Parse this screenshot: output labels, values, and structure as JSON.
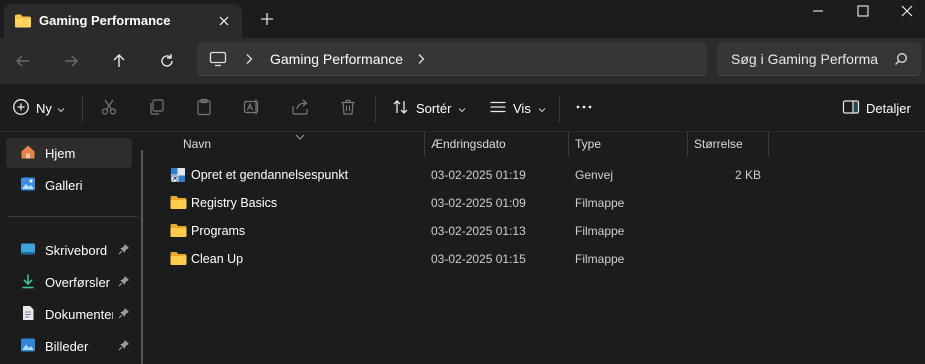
{
  "window": {
    "tab_title": "Gaming Performance",
    "controls": [
      "minimize-icon",
      "maximize-icon",
      "close-icon"
    ]
  },
  "address": {
    "crumb": "Gaming Performance"
  },
  "search": {
    "placeholder": "Søg i Gaming Performa"
  },
  "toolbar": {
    "new_label": "Ny",
    "sort_label": "Sortér",
    "view_label": "Vis",
    "details_label": "Detaljer"
  },
  "sidebar": {
    "items": [
      {
        "label": "Hjem",
        "icon": "home-icon"
      },
      {
        "label": "Galleri",
        "icon": "gallery-icon"
      },
      {
        "label": "Skrivebord",
        "icon": "desktop-icon"
      },
      {
        "label": "Overførsler",
        "icon": "downloads-icon"
      },
      {
        "label": "Dokumenter",
        "icon": "documents-icon"
      },
      {
        "label": "Billeder",
        "icon": "pictures-icon"
      }
    ]
  },
  "columns": {
    "name": "Navn",
    "date": "Ændringsdato",
    "type": "Type",
    "size": "Størrelse"
  },
  "files": [
    {
      "name": "Opret et gendannelsespunkt",
      "date": "03-02-2025 01:19",
      "type": "Genvej",
      "size": "2 KB",
      "icon": "shortcut-icon"
    },
    {
      "name": "Registry Basics",
      "date": "03-02-2025 01:09",
      "type": "Filmappe",
      "size": "",
      "icon": "folder-icon"
    },
    {
      "name": "Programs",
      "date": "03-02-2025 01:13",
      "type": "Filmappe",
      "size": "",
      "icon": "folder-icon"
    },
    {
      "name": "Clean Up",
      "date": "03-02-2025 01:15",
      "type": "Filmappe",
      "size": "",
      "icon": "folder-icon"
    }
  ],
  "colors": {
    "accent": "#4cc2ff",
    "folder": "#f5c142"
  }
}
